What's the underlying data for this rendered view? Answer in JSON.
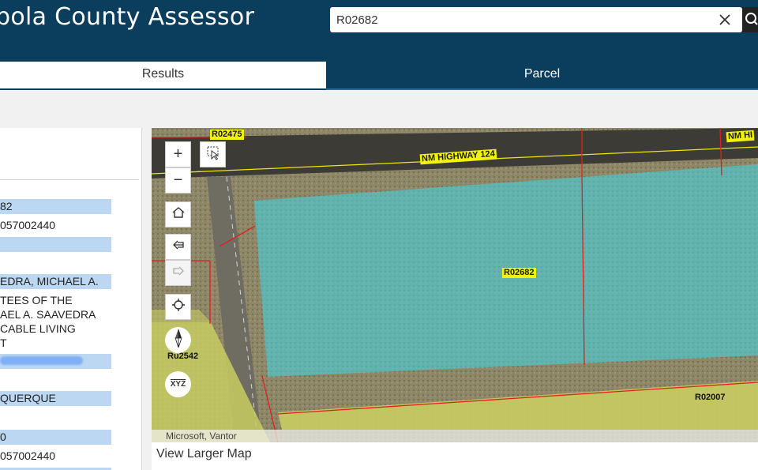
{
  "header": {
    "title": "bola County Assessor",
    "bg_color": "#0b3d5c"
  },
  "search": {
    "value": "R02682",
    "clear_icon": "close-icon",
    "search_icon": "search-icon"
  },
  "tabs": [
    {
      "label": "Results",
      "active": false
    },
    {
      "label": "Parcel",
      "active": true
    }
  ],
  "left_panel": {
    "lines": [
      "82",
      "057002440",
      "EDRA, MICHAEL A.",
      "TEES OF THE",
      "AEL A. SAAVEDRA",
      "CABLE LIVING",
      "T",
      "QUERQUE",
      "0",
      "057002440"
    ]
  },
  "map": {
    "labels": {
      "parcel_top_left": "R02475",
      "road": "NM HIGHWAY 124",
      "road_right": "NM HI",
      "parcel_selected": "R02682",
      "parcel_left": "Ru2542",
      "parcel_right": "R02007"
    },
    "attribution": "Microsoft, Vantor",
    "buttons": {
      "zoom_in": "+",
      "zoom_out": "−",
      "coords": "XYZ"
    },
    "highlight_color": "#3fd6e8",
    "parcel_line_color": "#e02020"
  },
  "footer": {
    "view_larger": "View Larger Map"
  }
}
